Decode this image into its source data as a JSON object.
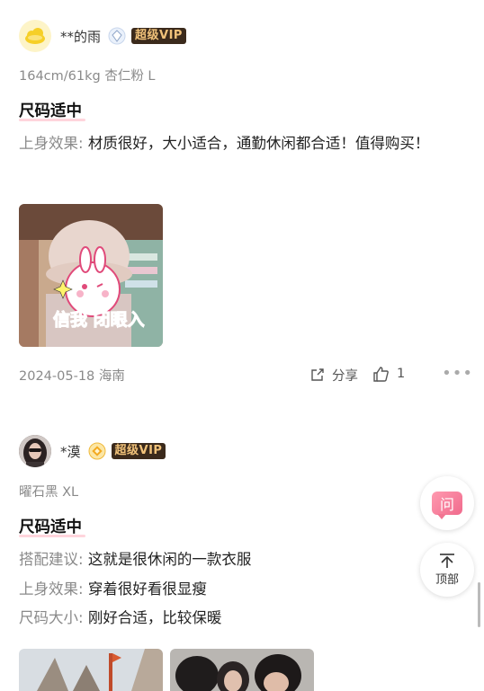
{
  "reviews": [
    {
      "username": "**的雨",
      "vip_label": "超级VIP",
      "spec": "164cm/61kg   杏仁粉 L",
      "fit_label": "尺码适中",
      "comments": [
        {
          "label": "上身效果:",
          "text": "材质很好，大小适合，通勤休闲都合适！值得购买！"
        }
      ],
      "photo_sticker_text": "信我 闭眼入",
      "date_location": "2024-05-18 海南",
      "share_label": "分享",
      "like_count": "1",
      "avatar_icon": "cloud-avatar-icon",
      "badge_icon": "diamond-level-icon"
    },
    {
      "username": "*漠",
      "vip_label": "超级VIP",
      "spec": "曜石黑 XL",
      "fit_label": "尺码适中",
      "comments": [
        {
          "label": "搭配建议:",
          "text": "这就是很休闲的一款衣服"
        },
        {
          "label": "上身效果:",
          "text": "穿着很好看很显瘦"
        },
        {
          "label": "尺码大小:",
          "text": "刚好合适，比较保暖"
        }
      ],
      "avatar_icon": "photo-avatar",
      "badge_icon": "gold-level-icon"
    }
  ],
  "floating": {
    "ask_label": "问",
    "top_label": "顶部"
  },
  "colors": {
    "vip_bg": "#3b2a1c",
    "vip_text": "#f1c27a",
    "accent_pink": "#f06a8c"
  }
}
